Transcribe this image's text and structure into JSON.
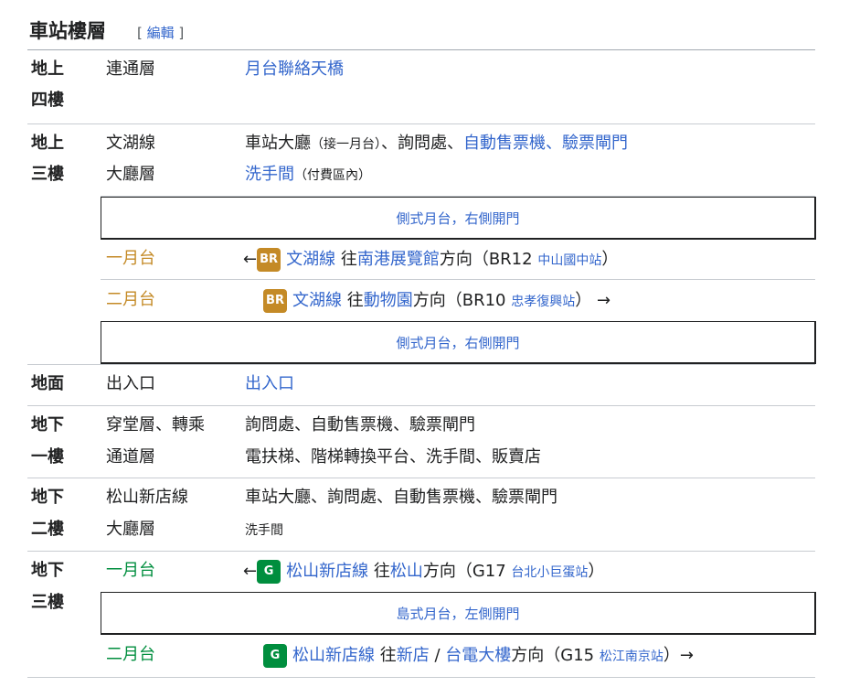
{
  "heading": "車站樓層",
  "edit_label": "編輯",
  "floors": {
    "f4": {
      "label1": "地上",
      "label2": "四樓",
      "col2": "連通層",
      "col3": "月台聯絡天橋"
    },
    "f3": {
      "label1": "地上",
      "label2": "三樓",
      "col2a": "文湖線",
      "col2b": "大廳層",
      "row1_a": "車站大廳",
      "row1_b": "（接一月台）",
      "row1_c": "、詢問處、",
      "row1_d": "自動售票機",
      "row1_e": "、",
      "row1_f": "驗票閘門",
      "row2_a": "洗手間",
      "row2_b": "（付費區內）"
    },
    "f3_box1": "側式月台，右側開門",
    "f3_p1": {
      "label": "一月台",
      "arrow": "←",
      "badge": "BR",
      "line": "文湖線",
      "dir_a": "往",
      "dir_b": "南港展覽館",
      "dir_c": "方向（BR12",
      "dir_d": "中山國中站",
      "dir_e": "）"
    },
    "f3_p2": {
      "label": "二月台",
      "badge": "BR",
      "line": "文湖線",
      "dir_a": "往",
      "dir_b": "動物園",
      "dir_c": "方向（BR10",
      "dir_d": "忠孝復興站",
      "dir_e": "）",
      "arrow": "→"
    },
    "f3_box2": "側式月台，右側開門",
    "g": {
      "label": "地面",
      "col2": "出入口",
      "col3": "出入口"
    },
    "b1": {
      "label1": "地下",
      "label2": "一樓",
      "col2a": "穿堂層、轉乘",
      "col2b": "通道層",
      "row1": "詢問處、自動售票機、驗票閘門",
      "row2": "電扶梯、階梯轉換平台、洗手間、販賣店"
    },
    "b2": {
      "label1": "地下",
      "label2": "二樓",
      "col2a": "松山新店線",
      "col2b": "大廳層",
      "row1": "車站大廳、詢問處、自動售票機、驗票閘門",
      "row2": "洗手間"
    },
    "b3": {
      "label1": "地下",
      "label2": "三樓"
    },
    "b3_p1": {
      "label": "一月台",
      "arrow": "←",
      "badge": "G",
      "line": "松山新店線",
      "dir_a": "往",
      "dir_b": "松山",
      "dir_c": "方向（G17",
      "dir_d": "台北小巨蛋站",
      "dir_e": "）"
    },
    "b3_box": "島式月台，左側開門",
    "b3_p2": {
      "label": "二月台",
      "badge": "G",
      "line": "松山新店線",
      "dir_a": "往",
      "dir_b": "新店",
      "dir_s": "/",
      "dir_b2": "台電大樓",
      "dir_c": "方向（G15",
      "dir_d": "松江南京站",
      "dir_e": "）",
      "arrow": "→"
    }
  },
  "colors": {
    "link": "#3366cc",
    "wenhu": "#c48a26",
    "songshan": "#008e3e"
  }
}
